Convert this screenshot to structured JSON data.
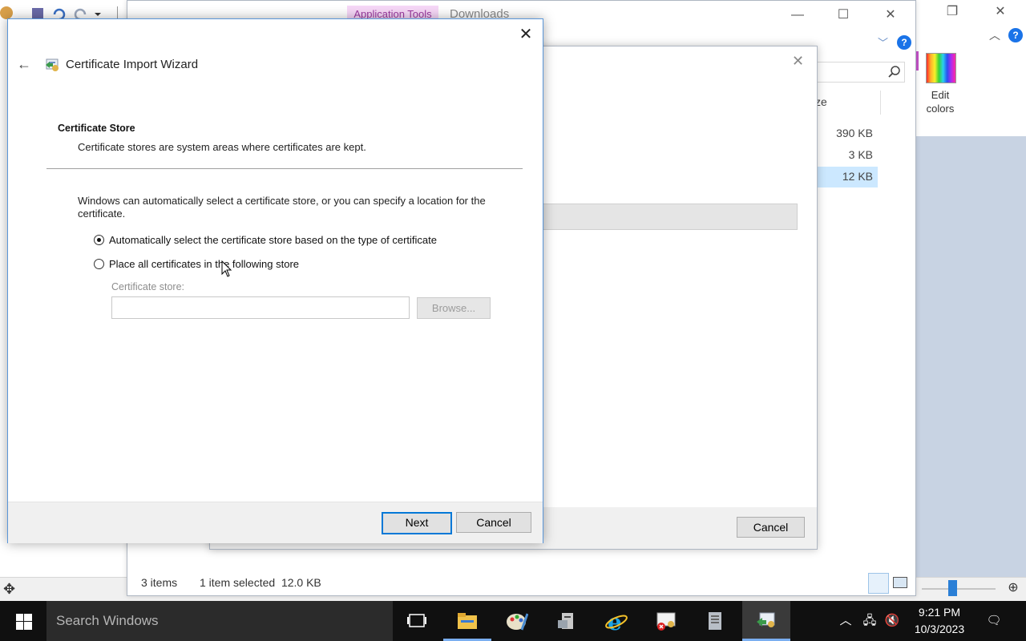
{
  "explorer": {
    "ribbon_tab": "Application Tools",
    "title": "Downloads",
    "column_header": "ze",
    "sizes": [
      "390 KB",
      "3 KB",
      "12 KB"
    ],
    "status": {
      "items": "3 items",
      "selected": "1 item selected  12.0 KB"
    },
    "help": "?"
  },
  "paint": {
    "edit_colors": {
      "line1": "Edit",
      "line2": "colors"
    },
    "help": "?"
  },
  "cert_dialog": {
    "cancel_label": "Cancel"
  },
  "wizard": {
    "title": "Certificate Import Wizard",
    "heading": "Certificate Store",
    "subheading": "Certificate stores are system areas where certificates are kept.",
    "description": "Windows can automatically select a certificate store, or you can specify a location for the certificate.",
    "option_auto": "Automatically select the certificate store based on the type of certificate",
    "option_manual": "Place all certificates in the following store",
    "selected_option": "auto",
    "store_label": "Certificate store:",
    "store_value": "",
    "browse_label": "Browse...",
    "next_label": "Next",
    "cancel_label": "Cancel"
  },
  "taskbar": {
    "search_placeholder": "Search Windows",
    "time": "9:21 PM",
    "date": "10/3/2023"
  },
  "colors": {
    "accent": "#0078d7",
    "taskbar": "#101010",
    "ribbon_tab_bg": "#f6d7f7"
  }
}
